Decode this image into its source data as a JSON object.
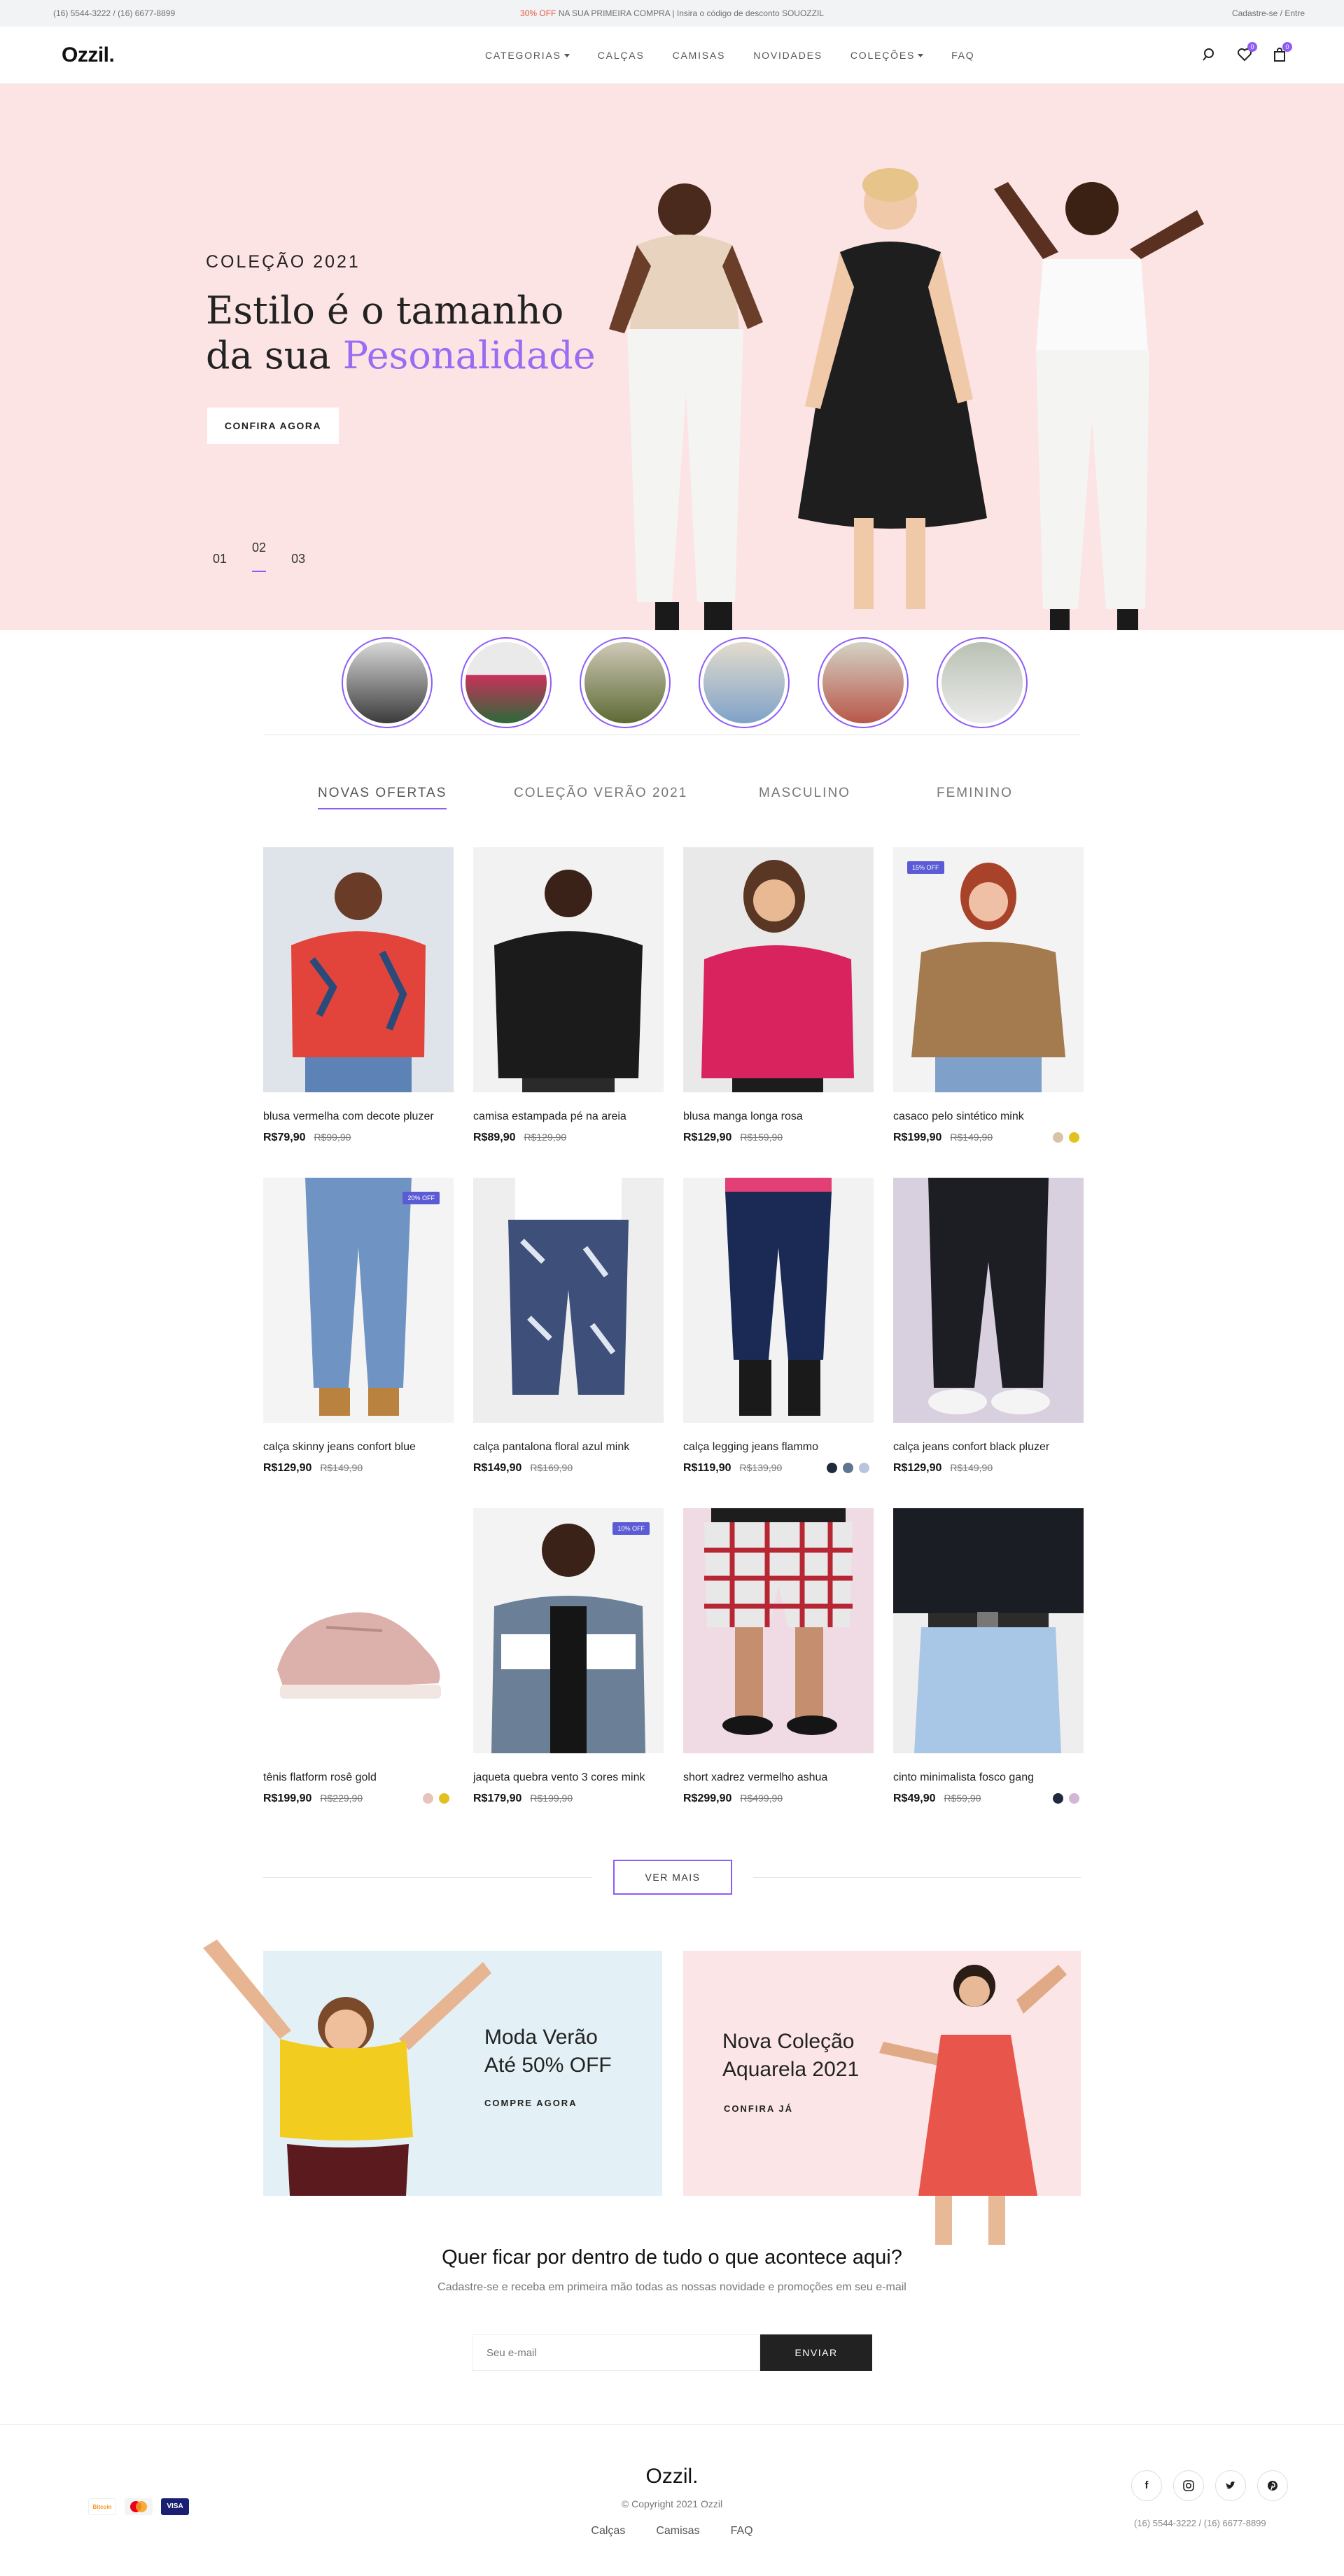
{
  "topbar": {
    "phones": "(16) 5544-3222  / (16) 6677-8899",
    "promo_highlight": "30% OFF",
    "promo_text": " NA SUA PRIMEIRA COMPRA | Insira o código de desconto SOUOZZIL",
    "account": "Cadastre-se / Entre"
  },
  "header": {
    "logo": "Ozzil.",
    "nav": [
      "CATEGORIAS",
      "CALÇAS",
      "CAMISAS",
      "NOVIDADES",
      "COLEÇÕES",
      "FAQ"
    ],
    "icons": [
      "search-icon",
      "heart-icon",
      "bag-icon"
    ],
    "wishlist_count": "0",
    "cart_count": "0"
  },
  "hero": {
    "eyebrow": "COLEÇÃO 2021",
    "title_line1": "Estilo é o tamanho",
    "title_line2": "da sua ",
    "title_accent": "Pesonalidade",
    "cta": "CONFIRA AGORA",
    "slides": [
      "01",
      "02",
      "03"
    ]
  },
  "tabs": [
    "NOVAS OFERTAS",
    "COLEÇÃO VERÃO 2021",
    "MASCULINO",
    "FEMININO"
  ],
  "products": [
    {
      "name": "blusa vermelha com decote pluzer",
      "price": "R$79,90",
      "old": "R$99,90"
    },
    {
      "name": "camisa estampada pé na areia",
      "price": "R$89,90",
      "old": "R$129,90"
    },
    {
      "name": "blusa manga longa rosa",
      "price": "R$129,90",
      "old": "R$159,90"
    },
    {
      "name": "casaco pelo sintético mink",
      "price": "R$199,90",
      "old": "R$149,90",
      "badge": "15% OFF"
    },
    {
      "name": "calça skinny jeans confort blue",
      "price": "R$129,90",
      "old": "R$149,90",
      "badge": "20% OFF"
    },
    {
      "name": "calça pantalona floral azul mink",
      "price": "R$149,90",
      "old": "R$169,90"
    },
    {
      "name": "calça legging jeans flammo",
      "price": "R$119,90",
      "old": "R$139,90"
    },
    {
      "name": "calça jeans confort black pluzer",
      "price": "R$129,90",
      "old": "R$149,90"
    },
    {
      "name": "tênis flatform rosê gold",
      "price": "R$199,90",
      "old": "R$229,90"
    },
    {
      "name": "jaqueta quebra vento 3 cores mink",
      "price": "R$179,90",
      "old": "R$199,90",
      "badge": "10% OFF"
    },
    {
      "name": "short xadrez vermelho ashua",
      "price": "R$299,90",
      "old": "R$499,90"
    },
    {
      "name": "cinto minimalista fosco gang",
      "price": "R$49,90",
      "old": "R$59,90"
    }
  ],
  "swatch_colors": {
    "casaco": [
      "#d9c2a7",
      "#e2c21f"
    ],
    "legging": [
      "#1f2a3c",
      "#5f7590",
      "#b7c6dc"
    ],
    "tenis": [
      "#e7c4bb",
      "#e3c021"
    ],
    "cinto": [
      "#1f2a3c",
      "#d4b5d4"
    ]
  },
  "ver_mais": "VER MAIS",
  "banners": [
    {
      "line1": "Moda Verão",
      "line2": "Até 50% OFF",
      "link": "COMPRE AGORA"
    },
    {
      "line1": "Nova Coleção",
      "line2": "Aquarela 2021",
      "link": "CONFIRA JÁ"
    }
  ],
  "newsletter": {
    "title": "Quer ficar por dentro de tudo o que acontece aqui?",
    "subtitle": "Cadastre-se e receba em primeira mão todas as nossas novidade e promoções em seu e-mail",
    "placeholder": "Seu e-mail",
    "button": "ENVIAR"
  },
  "footer": {
    "logo": "Ozzil.",
    "copyright": "© Copyright 2021 Ozzil",
    "links": [
      "Calças",
      "Camisas",
      "FAQ"
    ],
    "payments": [
      "Bitcoin",
      "Mastercard",
      "VISA"
    ],
    "socials": [
      "facebook-icon",
      "instagram-icon",
      "twitter-icon",
      "pinterest-icon"
    ],
    "phones": "(16) 5544-3222  / (16) 6677-8899"
  },
  "colors": {
    "accent": "#8f5cf6",
    "hero_bg": "#fce4e4",
    "banner1_bg": "#e3f1f6",
    "banner2_bg": "#fbe5e6",
    "badge_bg": "#5b5bd6",
    "promo_highlight": "#e8553e"
  }
}
